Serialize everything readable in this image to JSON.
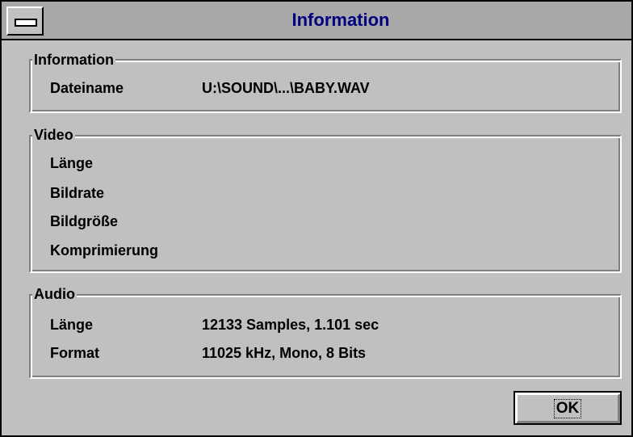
{
  "window": {
    "title": "Information"
  },
  "groups": {
    "information": {
      "label": "Information",
      "rows": [
        {
          "label": "Dateiname",
          "value": "U:\\SOUND\\...\\BABY.WAV"
        }
      ]
    },
    "video": {
      "label": "Video",
      "rows": [
        {
          "label": "Länge",
          "value": ""
        },
        {
          "label": "Bildrate",
          "value": ""
        },
        {
          "label": "Bildgröße",
          "value": ""
        },
        {
          "label": "Komprimierung",
          "value": ""
        }
      ]
    },
    "audio": {
      "label": "Audio",
      "rows": [
        {
          "label": "Länge",
          "value": "12133 Samples, 1.101 sec"
        },
        {
          "label": "Format",
          "value": "11025 kHz, Mono, 8 Bits"
        }
      ]
    }
  },
  "buttons": {
    "ok_label": "OK"
  },
  "colors": {
    "title_text": "#00007f",
    "dialog_face": "#c0c0c0",
    "titlebar": "#a8a8a8"
  },
  "icons": {
    "system_menu": "system-menu-icon"
  }
}
